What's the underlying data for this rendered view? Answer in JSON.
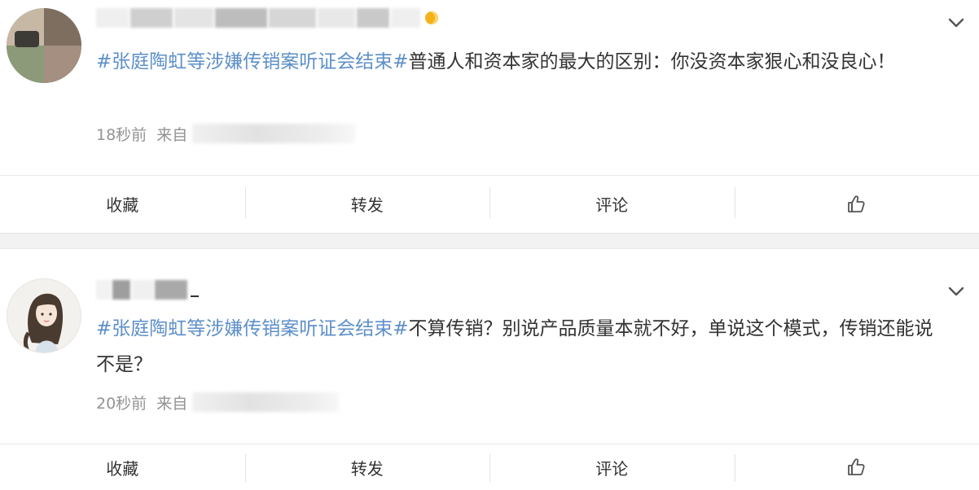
{
  "posts": [
    {
      "content_hashtag": "#张庭陶虹等涉嫌传销案听证会结束#",
      "content_text": "普通人和资本家的最大的区别：你没资本家狠心和没良心！",
      "time": "18秒前",
      "source_prefix": "来自",
      "actions": {
        "favorite": "收藏",
        "repost": "转发",
        "comment": "评论"
      }
    },
    {
      "content_hashtag": "#张庭陶虹等涉嫌传销案听证会结束#",
      "content_text": "不算传销？别说产品质量本就不好，单说这个模式，传销还能说不是？",
      "time": "20秒前",
      "source_prefix": "来自",
      "actions": {
        "favorite": "收藏",
        "repost": "转发",
        "comment": "评论"
      }
    }
  ],
  "icons": {
    "more": "chevron-down-icon",
    "like": "thumbs-up-icon",
    "vip": "vip-badge-icon"
  },
  "colors": {
    "hashtag": "#5d8fc9",
    "meta": "#939393",
    "text": "#333333",
    "separator": "#f2f2f2"
  }
}
